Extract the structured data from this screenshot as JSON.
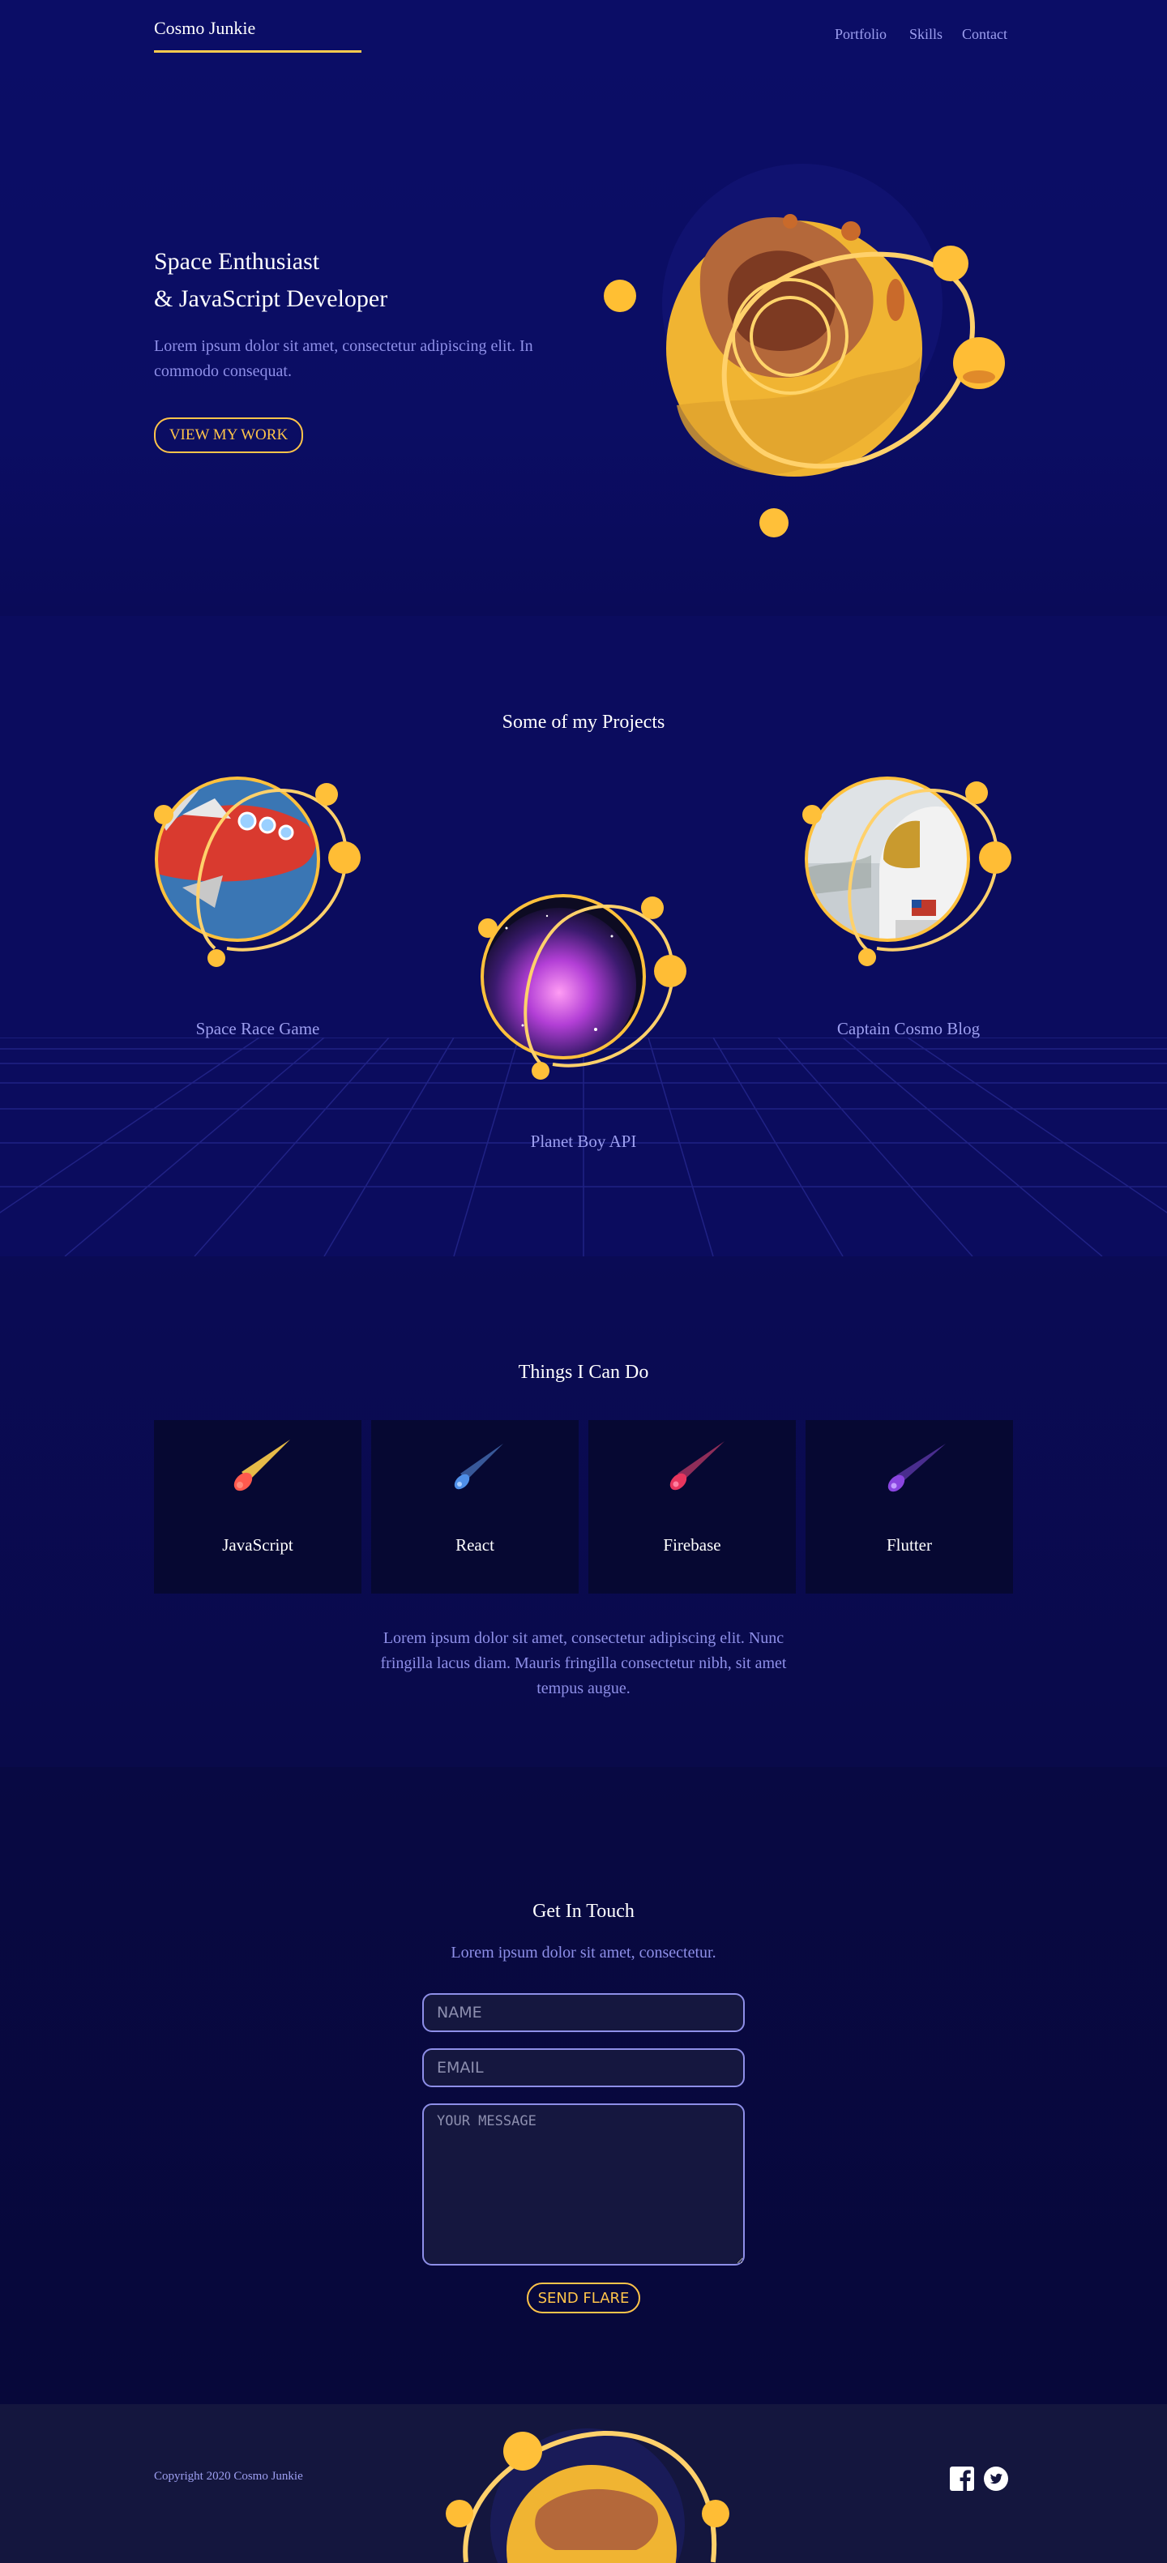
{
  "header": {
    "logo": "Cosmo Junkie",
    "nav": [
      "Portfolio",
      "Skills",
      "Contact"
    ]
  },
  "hero": {
    "title_line1": "Space Enthusiast",
    "title_line2": "& JavaScript Developer",
    "text": "Lorem ipsum dolor sit amet, consectetur adipiscing elit. In commodo consequat.",
    "button": "VIEW MY WORK"
  },
  "projects": {
    "title": "Some of my Projects",
    "items": [
      {
        "label": "Space Race Game",
        "image_icon": "rocket-icon"
      },
      {
        "label": "Planet Boy API",
        "image_icon": "nebula-icon"
      },
      {
        "label": "Captain Cosmo Blog",
        "image_icon": "astronaut-icon"
      }
    ]
  },
  "skills": {
    "title": "Things I Can Do",
    "items": [
      {
        "label": "JavaScript",
        "icon": "comet-icon",
        "color": "#ff5a4e"
      },
      {
        "label": "React",
        "icon": "comet-icon",
        "color": "#4f8fe8"
      },
      {
        "label": "Firebase",
        "icon": "comet-icon",
        "color": "#e8365e"
      },
      {
        "label": "Flutter",
        "icon": "comet-icon",
        "color": "#8a45e0"
      }
    ],
    "text": "Lorem ipsum dolor sit amet, consectetur adipiscing elit. Nunc fringilla lacus diam. Mauris fringilla consectetur nibh, sit amet tempus augue."
  },
  "contact": {
    "title": "Get In Touch",
    "subtitle": "Lorem ipsum dolor sit amet, consectetur.",
    "name_placeholder": "NAME",
    "email_placeholder": "EMAIL",
    "message_placeholder": "YOUR MESSAGE",
    "button": "SEND FLARE"
  },
  "footer": {
    "copyright": "Copyright 2020 Cosmo Junkie",
    "social_icons": [
      "facebook-icon",
      "twitter-icon"
    ]
  },
  "colors": {
    "background": "#0b0c5c",
    "accent": "#ffc44a",
    "link": "#9d9ff0",
    "footer": "#14163e"
  }
}
